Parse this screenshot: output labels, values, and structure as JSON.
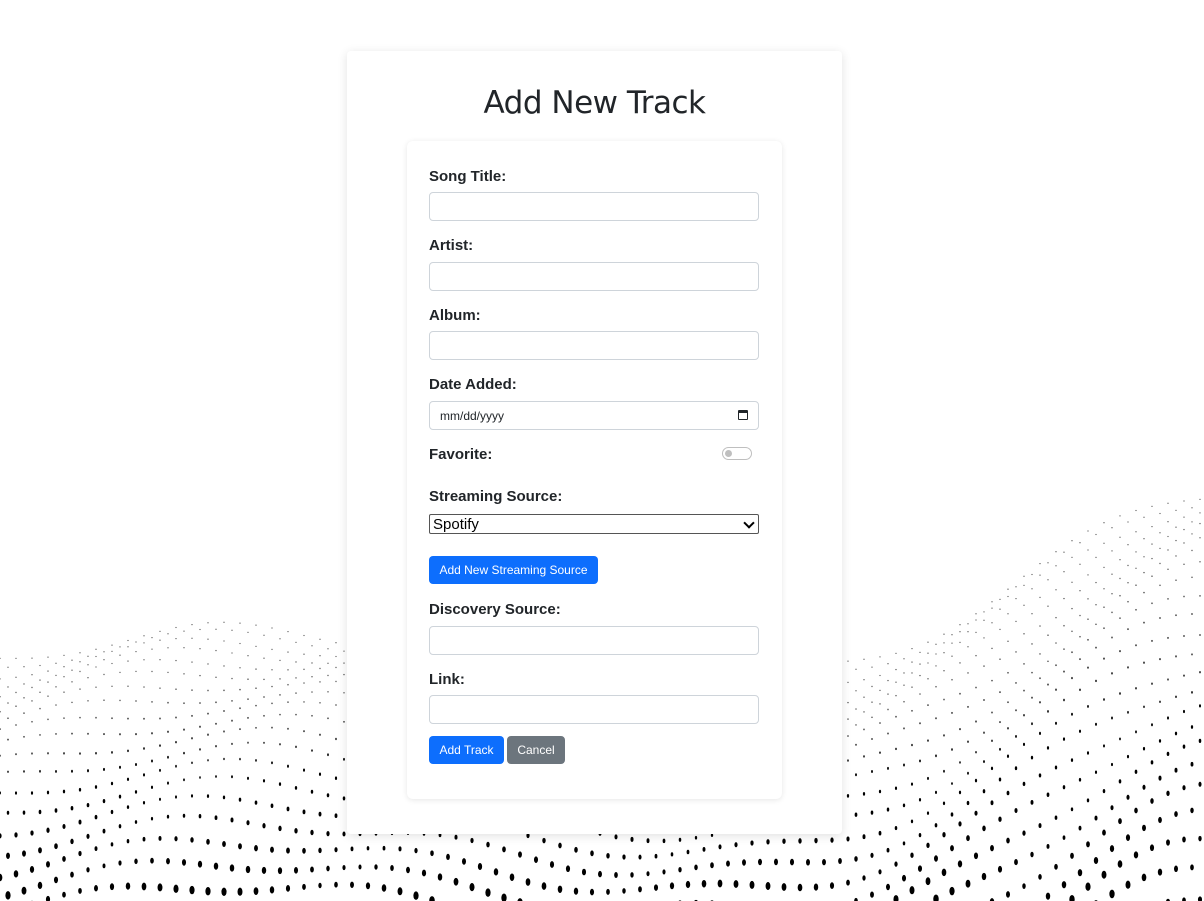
{
  "page": {
    "title": "Add New Track"
  },
  "form": {
    "song_title": {
      "label": "Song Title:",
      "value": ""
    },
    "artist": {
      "label": "Artist:",
      "value": ""
    },
    "album": {
      "label": "Album:",
      "value": ""
    },
    "date_added": {
      "label": "Date Added:",
      "placeholder": "mm/dd/yyyy"
    },
    "favorite": {
      "label": "Favorite:",
      "checked": false
    },
    "streaming_source": {
      "label": "Streaming Source:",
      "selected": "Spotify"
    },
    "add_streaming_source_label": "Add New Streaming Source",
    "discovery_source": {
      "label": "Discovery Source:",
      "value": ""
    },
    "link": {
      "label": "Link:",
      "value": ""
    },
    "submit_label": "Add Track",
    "cancel_label": "Cancel"
  },
  "colors": {
    "primary": "#0d6efd",
    "secondary": "#6c757d",
    "background_dots": "#000000"
  }
}
